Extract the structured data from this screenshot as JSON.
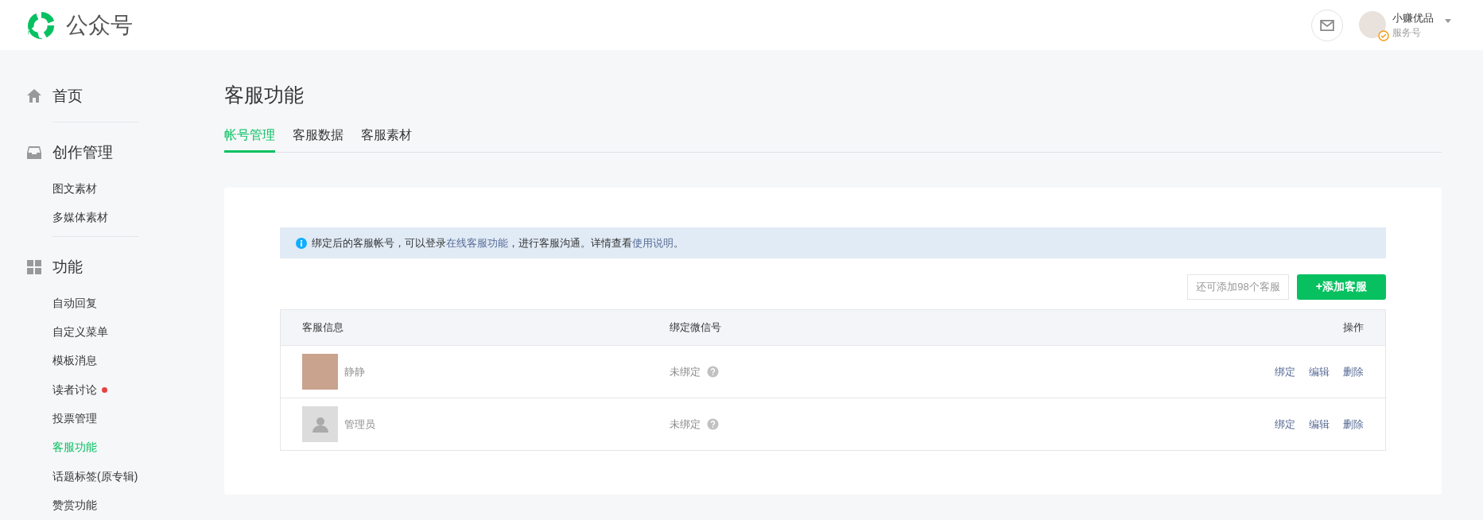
{
  "header": {
    "logo_text": "公众号",
    "account": {
      "name": "小赚优品",
      "type": "服务号",
      "verified": true
    }
  },
  "sidebar": [
    {
      "kind": "home",
      "title": "首页"
    },
    {
      "kind": "inbox",
      "title": "创作管理",
      "items": [
        {
          "label": "图文素材",
          "selected": false,
          "dot": false
        },
        {
          "label": "多媒体素材",
          "selected": false,
          "dot": false
        }
      ]
    },
    {
      "kind": "grid",
      "title": "功能",
      "items": [
        {
          "label": "自动回复",
          "selected": false,
          "dot": false
        },
        {
          "label": "自定义菜单",
          "selected": false,
          "dot": false
        },
        {
          "label": "模板消息",
          "selected": false,
          "dot": false
        },
        {
          "label": "读者讨论",
          "selected": false,
          "dot": true
        },
        {
          "label": "投票管理",
          "selected": false,
          "dot": false
        },
        {
          "label": "客服功能",
          "selected": true,
          "dot": false
        },
        {
          "label": "话题标签(原专辑)",
          "selected": false,
          "dot": false
        },
        {
          "label": "赞赏功能",
          "selected": false,
          "dot": false
        }
      ]
    }
  ],
  "page_title": "客服功能",
  "tabs": [
    {
      "label": "帐号管理",
      "selected": true
    },
    {
      "label": "客服数据",
      "selected": false
    },
    {
      "label": "客服素材",
      "selected": false
    }
  ],
  "notice": [
    {
      "kind": "text",
      "text": "绑定后的客服帐号，可以登录"
    },
    {
      "kind": "link",
      "text": "在线客服功能"
    },
    {
      "kind": "text",
      "text": "，进行客服沟通。详情查看"
    },
    {
      "kind": "link",
      "text": "使用说明"
    },
    {
      "kind": "text",
      "text": "。"
    }
  ],
  "quota_hint": "还可添加98个客服",
  "add_button": "+添加客服",
  "table": {
    "columns": [
      "客服信息",
      "绑定微信号",
      "操作"
    ],
    "rows": [
      {
        "kind": "photo",
        "name": "静静",
        "wechat": "未绑定",
        "actions": [
          "绑定",
          "编辑",
          "删除"
        ]
      },
      {
        "kind": "default",
        "name": "管理员",
        "wechat": "未绑定",
        "actions": [
          "绑定",
          "编辑",
          "删除"
        ]
      }
    ]
  }
}
